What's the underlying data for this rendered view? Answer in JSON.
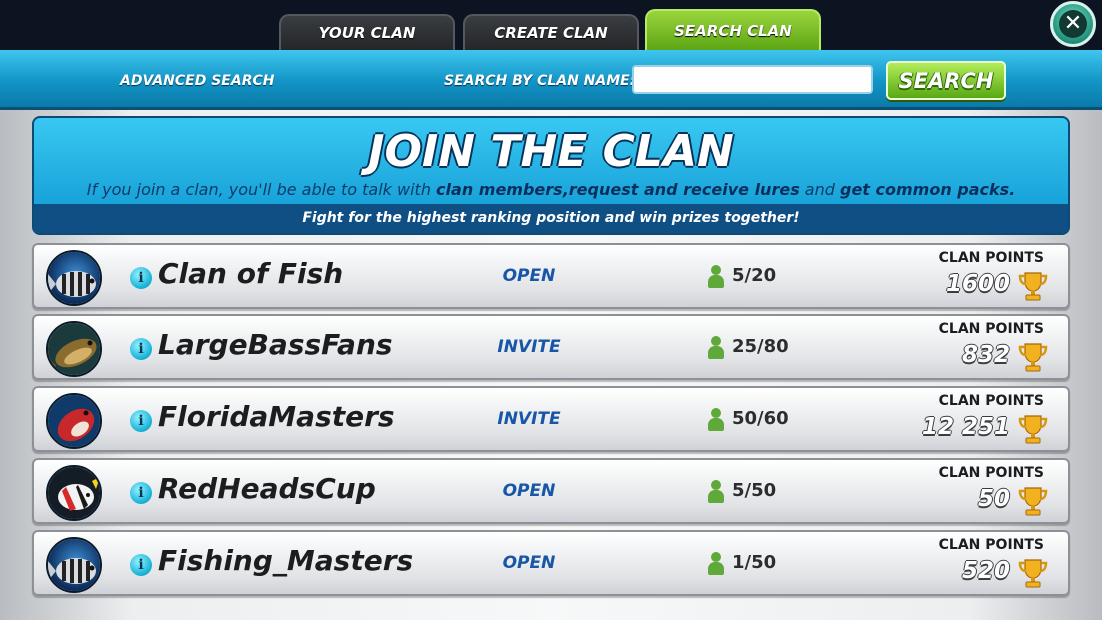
{
  "tabs": [
    {
      "label": "YOUR CLAN",
      "active": false
    },
    {
      "label": "CREATE CLAN",
      "active": false
    },
    {
      "label": "SEARCH CLAN",
      "active": true
    }
  ],
  "close_icon": "close-x-icon",
  "search": {
    "advanced_label": "ADVANCED SEARCH",
    "name_label": "SEARCH BY CLAN NAME:",
    "value": "",
    "button_label": "SEARCH"
  },
  "banner": {
    "title": "JOIN THE CLAN",
    "desc_1": "If you join a clan, you'll be able to talk with ",
    "desc_b1": "clan members,request and receive lures",
    "desc_2": " and ",
    "desc_b2": "get common packs.",
    "footer": "Fight for the highest ranking position and win prizes together!"
  },
  "points_label": "CLAN POINTS",
  "clans": [
    {
      "name": "Clan of Fish",
      "status": "OPEN",
      "members": "5/20",
      "points": "1600",
      "avatar": "striped-fish"
    },
    {
      "name": "LargeBassFans",
      "status": "INVITE",
      "members": "25/80",
      "points": "832",
      "avatar": "bass-fish"
    },
    {
      "name": "FloridaMasters",
      "status": "INVITE",
      "members": "50/60",
      "points": "12 251",
      "avatar": "red-fish"
    },
    {
      "name": "RedHeadsCup",
      "status": "OPEN",
      "members": "5/50",
      "points": "50",
      "avatar": "tropical-fish"
    },
    {
      "name": "Fishing_Masters",
      "status": "OPEN",
      "members": "1/50",
      "points": "520",
      "avatar": "striped-fish"
    }
  ],
  "colors": {
    "header_blue": "#1295c6",
    "active_tab_green": "#7cc22a",
    "status_blue": "#1856a8",
    "member_green": "#5fa83a",
    "trophy_gold": "#f2b21f"
  }
}
